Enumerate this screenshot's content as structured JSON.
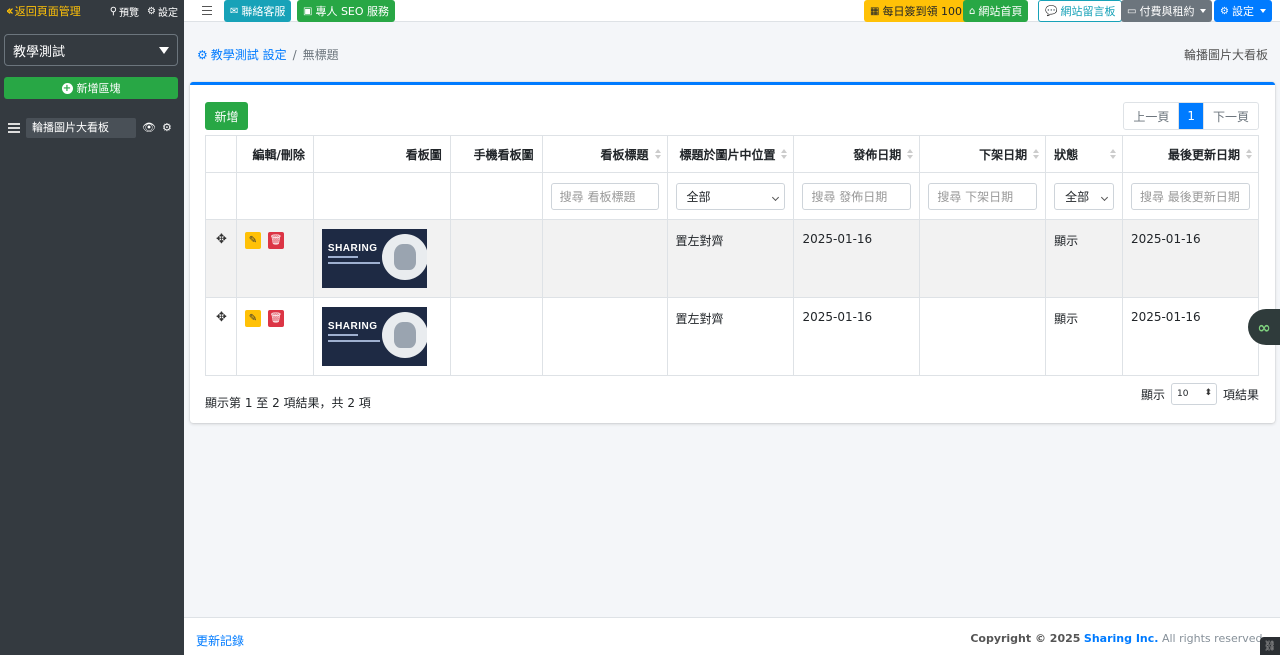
{
  "sidebar": {
    "back_label": "返回頁面管理",
    "preview_label": "預覽",
    "settings_label": "設定",
    "site_select": "教學測試",
    "add_block_label": "新增區塊",
    "items": [
      {
        "label": "輪播圖片大看板"
      }
    ]
  },
  "navbar": {
    "contact_label": "聯絡客服",
    "seo_label": "專人 SEO 服務",
    "checkin_label": "每日簽到領 100",
    "home_label": "網站首頁",
    "guestbook_label": "網站留言板",
    "billing_label": "付費與租約",
    "settings_label": "設定"
  },
  "breadcrumb": {
    "root": "教學測試 設定",
    "separator": "/",
    "current": "無標題"
  },
  "page_title": "輪播圖片大看板",
  "toolbar": {
    "add_label": "新增"
  },
  "pagination": {
    "prev": "上一頁",
    "page": "1",
    "next": "下一頁"
  },
  "table": {
    "headers": [
      "",
      "編輯/刪除",
      "看板圖",
      "手機看板圖",
      "看板標題",
      "標題於圖片中位置",
      "發佈日期",
      "下架日期",
      "狀態",
      "最後更新日期"
    ],
    "filters": {
      "title_placeholder": "搜尋 看板標題",
      "position_value": "全部",
      "publish_placeholder": "搜尋 發佈日期",
      "unpublish_placeholder": "搜尋 下架日期",
      "status_value": "全部",
      "updated_placeholder": "搜尋 最後更新日期"
    },
    "rows": [
      {
        "image_text": "SHARING",
        "title": "",
        "position": "置左對齊",
        "publish": "2025-01-16",
        "unpublish": "",
        "status": "顯示",
        "updated": "2025-01-16"
      },
      {
        "image_text": "SHARING",
        "title": "",
        "position": "置左對齊",
        "publish": "2025-01-16",
        "unpublish": "",
        "status": "顯示",
        "updated": "2025-01-16"
      }
    ]
  },
  "summary": "顯示第 1 至 2 項結果，共 2 項",
  "length": {
    "prefix": "顯示",
    "value": "10",
    "suffix": "項結果"
  },
  "footer": {
    "changelog": "更新記錄",
    "copyright_prefix": "Copyright © 2025",
    "company": "Sharing Inc.",
    "rights": "All rights reserved."
  },
  "colors": {
    "sidebar_bg": "#343a40",
    "primary": "#007bff",
    "success": "#28a745",
    "warning": "#ffc107",
    "danger": "#dc3545",
    "info": "#17a2b8"
  }
}
